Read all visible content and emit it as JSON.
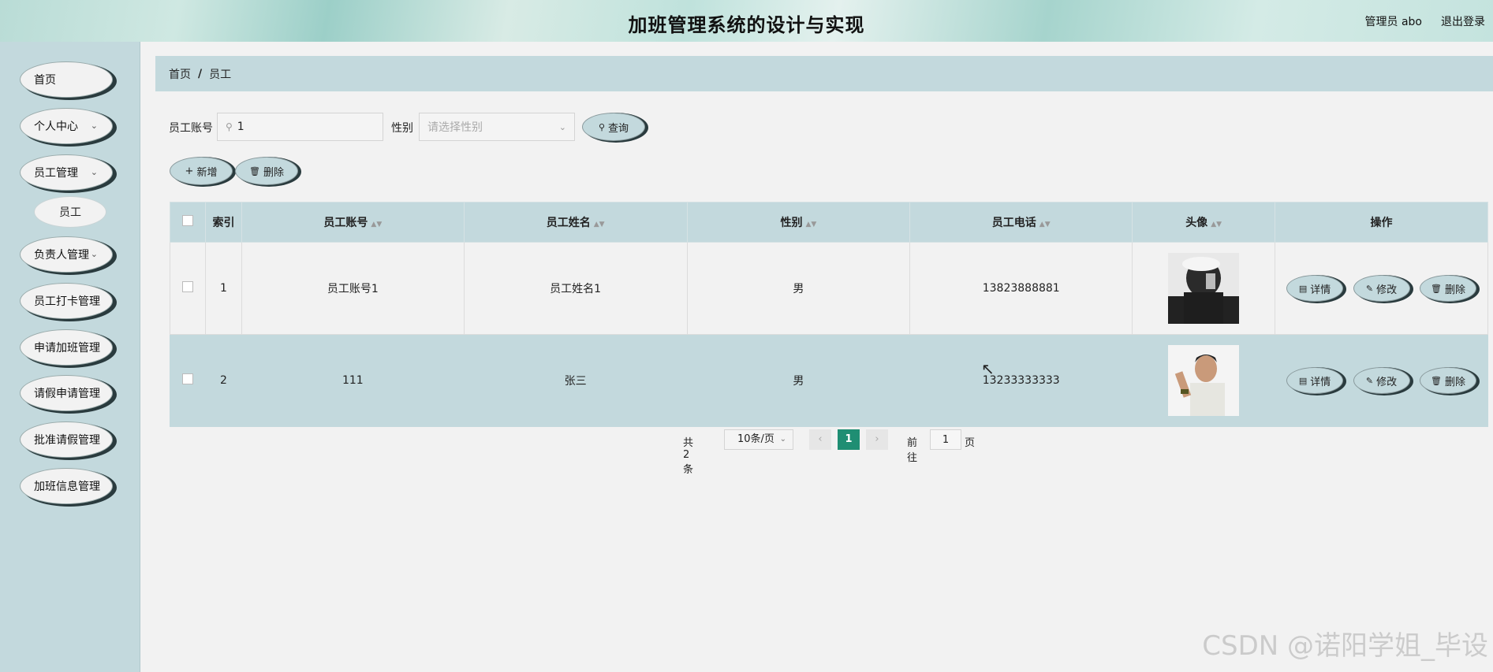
{
  "header": {
    "title": "加班管理系统的设计与实现",
    "user_label": "管理员 abo",
    "logout_label": "退出登录"
  },
  "sidebar": {
    "items": [
      {
        "label": "首页"
      },
      {
        "label": "个人中心"
      },
      {
        "label": "员工管理"
      },
      {
        "label": "负责人管理"
      },
      {
        "label": "员工打卡管理"
      },
      {
        "label": "申请加班管理"
      },
      {
        "label": "请假申请管理"
      },
      {
        "label": "批准请假管理"
      },
      {
        "label": "加班信息管理"
      }
    ],
    "sub_item": "员工"
  },
  "breadcrumb": {
    "home": "首页",
    "sep": "/",
    "current": "员工"
  },
  "search": {
    "account_label": "员工账号",
    "account_value": "1",
    "gender_label": "性别",
    "gender_placeholder": "请选择性别",
    "query_label": "查询"
  },
  "actions": {
    "add_label": "新增",
    "delete_label": "删除"
  },
  "table": {
    "columns": [
      "索引",
      "员工账号",
      "员工姓名",
      "性别",
      "员工电话",
      "头像",
      "操作"
    ],
    "rows": [
      {
        "index": "1",
        "account": "员工账号1",
        "name": "员工姓名1",
        "gender": "男",
        "phone": "13823888881"
      },
      {
        "index": "2",
        "account": "111",
        "name": "张三",
        "gender": "男",
        "phone": "13233333333"
      }
    ],
    "row_actions": {
      "detail": "详情",
      "edit": "修改",
      "delete": "删除"
    }
  },
  "pagination": {
    "total": "共 2 条",
    "page_size": "10条/页",
    "current_page": "1",
    "goto_label": "前往",
    "goto_value": "1",
    "page_unit": "页"
  },
  "watermark": "CSDN @诺阳学姐_毕设"
}
